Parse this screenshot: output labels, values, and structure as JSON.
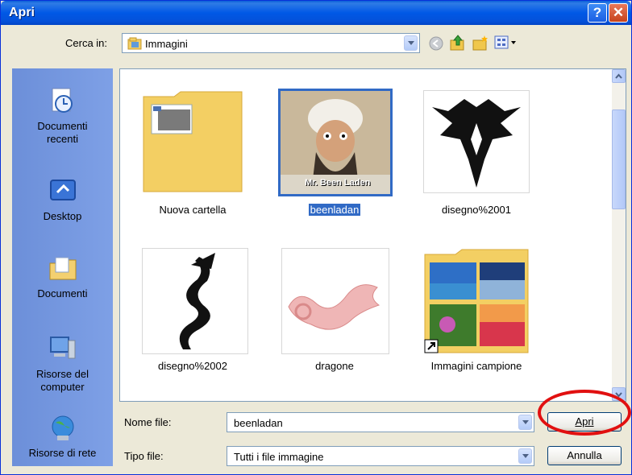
{
  "window": {
    "title": "Apri"
  },
  "toolbar": {
    "look_in_label": "Cerca in:",
    "look_in_value": "Immagini",
    "back_icon": "back-icon",
    "up_icon": "up-folder-icon",
    "new_folder_icon": "new-folder-icon",
    "view_menu_icon": "view-menu-icon"
  },
  "places": [
    {
      "label_line1": "Documenti",
      "label_line2": "recenti",
      "icon": "recent-documents-icon"
    },
    {
      "label_line1": "Desktop",
      "label_line2": "",
      "icon": "desktop-icon"
    },
    {
      "label_line1": "Documenti",
      "label_line2": "",
      "icon": "documents-icon"
    },
    {
      "label_line1": "Risorse del",
      "label_line2": "computer",
      "icon": "my-computer-icon"
    },
    {
      "label_line1": "Risorse di rete",
      "label_line2": "",
      "icon": "network-icon"
    }
  ],
  "files": [
    {
      "name": "Nuova cartella",
      "type": "folder"
    },
    {
      "name": "beenladan",
      "type": "image",
      "selected": true,
      "thumb_text": "Mr. Been Laden"
    },
    {
      "name": "disegno%2001",
      "type": "image"
    },
    {
      "name": "disegno%2002",
      "type": "image"
    },
    {
      "name": "dragone",
      "type": "image"
    },
    {
      "name": "Immagini campione",
      "type": "folder-shortcut"
    }
  ],
  "footer": {
    "filename_label": "Nome file:",
    "filename_value": "beenladan",
    "filetype_label": "Tipo file:",
    "filetype_value": "Tutti i file immagine",
    "open_button": "Apri",
    "cancel_button": "Annulla"
  },
  "colors": {
    "selection": "#316ac5",
    "titlebar": "#0058e6",
    "highlight_circle": "#e11010"
  }
}
